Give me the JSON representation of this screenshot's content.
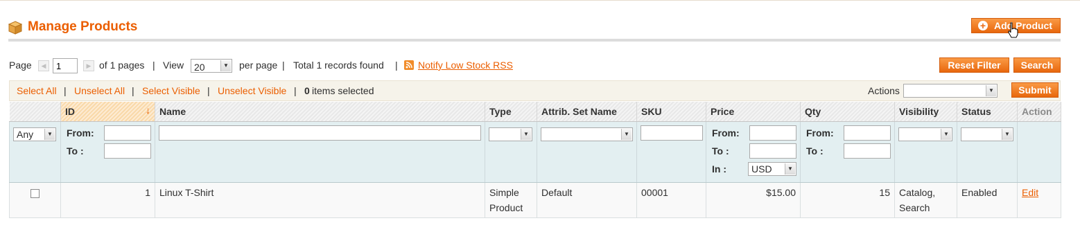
{
  "header": {
    "title": "Manage Products",
    "add_button": "Add Product"
  },
  "pager": {
    "page_label": "Page",
    "page_value": "1",
    "of_pages": "of 1 pages",
    "sep": "|",
    "view_label": "View",
    "per_page_value": "20",
    "per_page_label": "per page",
    "total": "Total 1 records found",
    "rss_link": "Notify Low Stock RSS"
  },
  "buttons": {
    "reset_filter": "Reset Filter",
    "search": "Search",
    "submit": "Submit"
  },
  "massaction": {
    "select_all": "Select All",
    "unselect_all": "Unselect All",
    "select_visible": "Select Visible",
    "unselect_visible": "Unselect Visible",
    "selected_count": "0",
    "selected_label": "items selected",
    "actions_label": "Actions",
    "sep": "|"
  },
  "grid": {
    "columns": [
      "ID",
      "Name",
      "Type",
      "Attrib. Set Name",
      "SKU",
      "Price",
      "Qty",
      "Visibility",
      "Status",
      "Action"
    ],
    "sort_arrow": "↓",
    "filters": {
      "massaction_value": "Any",
      "from_label": "From:",
      "to_label": "To :",
      "in_label": "In :",
      "currency": "USD"
    },
    "rows": [
      {
        "id": "1",
        "name": "Linux T-Shirt",
        "type_line1": "Simple",
        "type_line2": "Product",
        "attrib_set": "Default",
        "sku": "00001",
        "price": "$15.00",
        "qty": "15",
        "visibility_line1": "Catalog,",
        "visibility_line2": "Search",
        "status": "Enabled",
        "action": "Edit"
      }
    ]
  },
  "colors": {
    "accent": "#eb5e00",
    "button": "#ed7b1f",
    "filter_bg": "#e3eff1",
    "mass_bg": "#f6f3ea"
  },
  "icons": {
    "header": "box-icon",
    "add": "plus-circle-icon",
    "cursor": "hand-cursor-icon",
    "rss": "rss-icon"
  }
}
